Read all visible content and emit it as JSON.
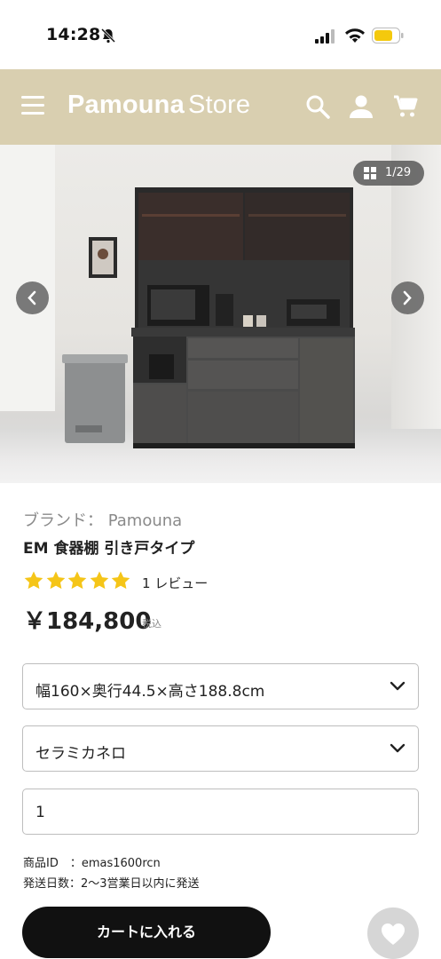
{
  "status_bar": {
    "time": "14:28"
  },
  "header": {
    "brand_bold": "Pamouna",
    "brand_light": "Store",
    "icons": [
      "menu-icon",
      "search-icon",
      "user-icon",
      "cart-icon"
    ],
    "background_color": "#d9cfb0"
  },
  "gallery": {
    "counter": "1/29",
    "icons": [
      "grid-icon",
      "chevron-left-icon",
      "chevron-right-icon"
    ]
  },
  "product": {
    "brand_line": "ブランド： Pamouna",
    "name": "EM 食器棚 引き戸タイプ",
    "rating_stars": 5,
    "star_color": "#f5c518",
    "review_count": "1 レビュー",
    "price": "￥184,800",
    "tax_label": "税込"
  },
  "options": {
    "size_selected": "幅160×奥行44.5×高さ188.8cm",
    "color_selected": "セラミカネロ",
    "quantity": "1"
  },
  "meta": {
    "product_id": "商品ID　：emas1600rcn",
    "shipping_days": "発送日数：2〜3営業日以内に発送"
  },
  "actions": {
    "add_to_cart": "カートに入れる",
    "favorite_icon": "heart-icon"
  }
}
